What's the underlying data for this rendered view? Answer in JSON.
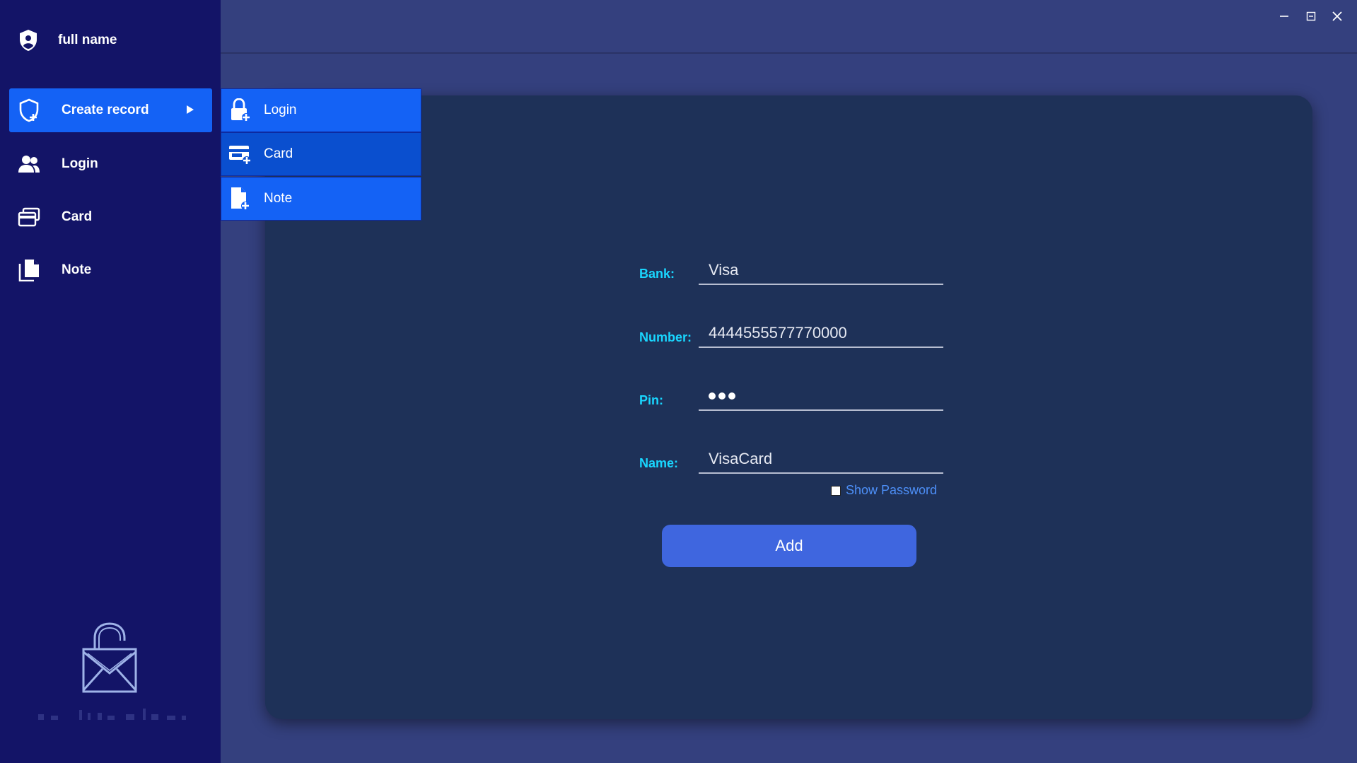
{
  "user": {
    "name": "full name"
  },
  "sidebar": {
    "items": [
      {
        "label": "Create record",
        "icon": "shield-plus-icon",
        "active": true
      },
      {
        "label": "Login",
        "icon": "users-icon"
      },
      {
        "label": "Card",
        "icon": "card-stack-icon"
      },
      {
        "label": "Note",
        "icon": "documents-icon"
      }
    ]
  },
  "submenu": {
    "items": [
      {
        "label": "Login",
        "icon": "lock-plus-icon"
      },
      {
        "label": "Card",
        "icon": "card-plus-icon"
      },
      {
        "label": "Note",
        "icon": "note-plus-icon"
      }
    ]
  },
  "form": {
    "bank_label": "Bank:",
    "bank_value": "Visa",
    "number_label": "Number:",
    "number_value": "4444555577770000",
    "pin_label": "Pin:",
    "pin_masked_count": 3,
    "name_label": "Name:",
    "name_value": "VisaCard",
    "show_password_label": "Show Password",
    "show_password_checked": false,
    "add_label": "Add"
  },
  "colors": {
    "sidebar_bg": "#131467",
    "accent": "#1462f5",
    "label_cyan": "#19d6ff",
    "panel_bg": "#1e3158",
    "button": "#3f66df"
  }
}
